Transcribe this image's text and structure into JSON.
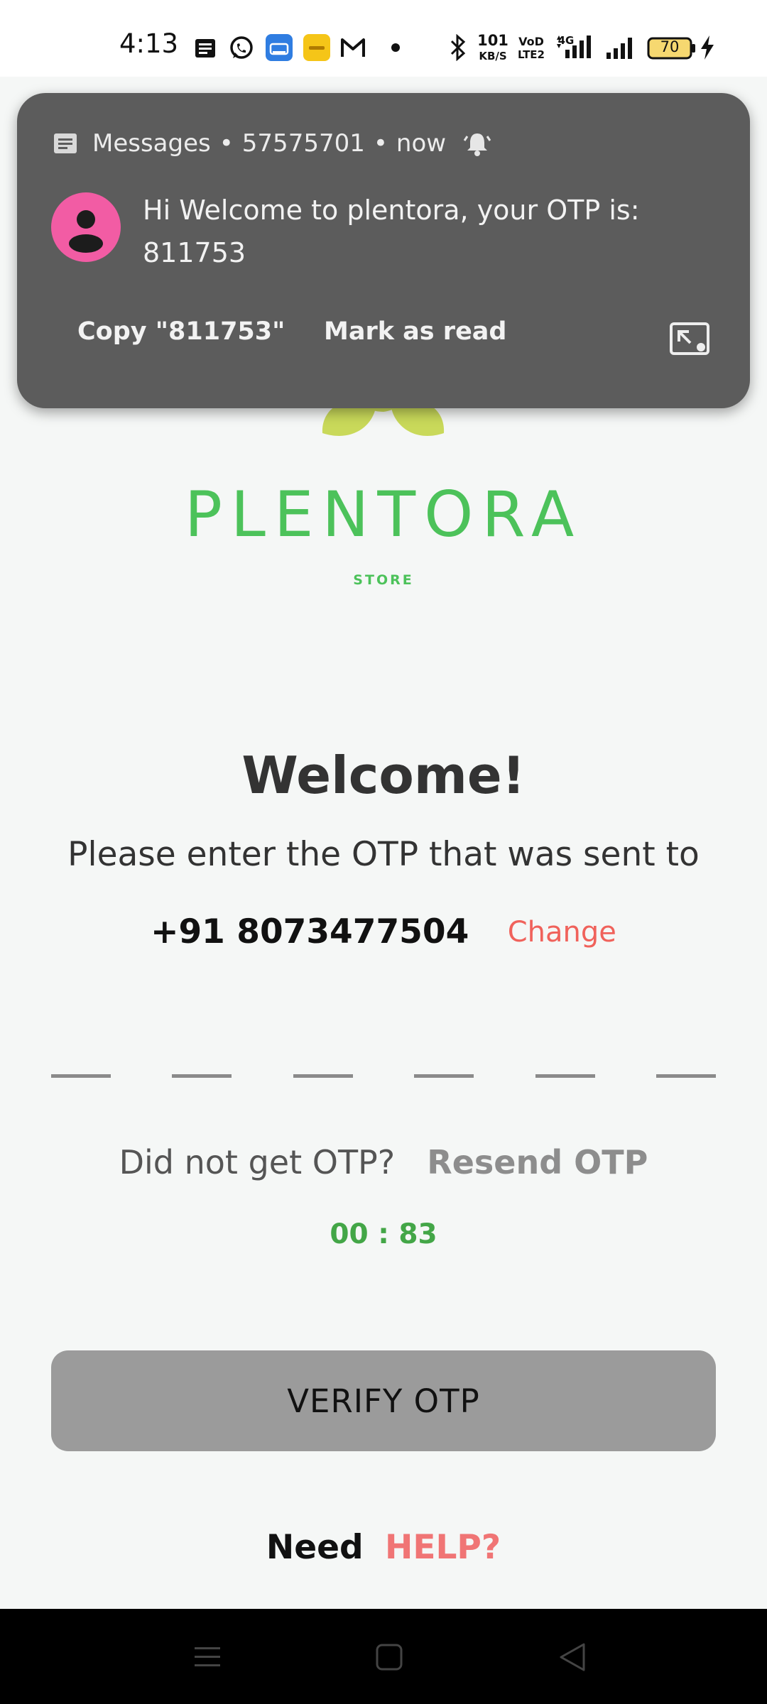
{
  "status_bar": {
    "time": "4:13",
    "net_speed_value": "101",
    "net_speed_unit": "KB/S",
    "volte_top": "VoD",
    "volte_bottom": "LTE2",
    "net_type": "4G",
    "battery_level": "70",
    "icons": [
      "messages-icon",
      "whatsapp-icon",
      "app-icon-blue",
      "app-icon-yellow",
      "gmail-icon",
      "dot-icon",
      "bluetooth-icon",
      "signal-icon",
      "signal-icon-2",
      "battery-icon",
      "charging-icon"
    ]
  },
  "notification": {
    "app_name": "Messages",
    "sender": "57575701",
    "time": "now",
    "message": "Hi Welcome to plentora, your OTP is: 811753",
    "actions": {
      "copy": "Copy \"811753\"",
      "mark_read": "Mark as read"
    },
    "colors": {
      "background": "#5c5c5c",
      "avatar": "#f25ca4"
    }
  },
  "logo": {
    "brand": "PLENTORA",
    "sub": "STORE",
    "colors": {
      "leaf": "#c9d95a",
      "text": "#4cc25a"
    }
  },
  "main": {
    "title": "Welcome!",
    "instruction": "Please enter the OTP that was sent to",
    "phone": "+91 8073477504",
    "change_label": "Change",
    "otp_digits": [
      "",
      "",
      "",
      "",
      "",
      ""
    ],
    "resend_question": "Did not get OTP?",
    "resend_label": "Resend OTP",
    "timer": "00 : 83",
    "verify_label": "VERIFY OTP",
    "help_prefix": "Need",
    "help_link": "HELP?"
  },
  "colors": {
    "accent_red": "#f0625b",
    "timer_green": "#43a647",
    "button_gray": "#9b9b9b"
  }
}
